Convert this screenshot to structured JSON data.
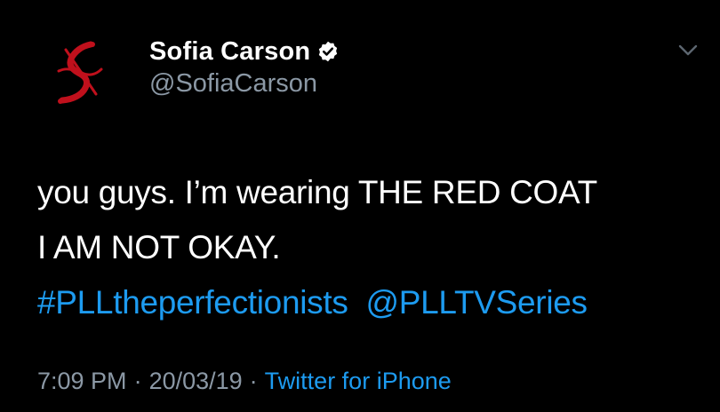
{
  "tweet": {
    "author": {
      "display_name": "Sofia Carson",
      "handle": "@SofiaCarson",
      "verified": true,
      "avatar_icon": "red-s-monogram-icon"
    },
    "body": {
      "line1": "you guys. I’m wearing THE RED COAT",
      "line2": "I AM NOT OKAY.",
      "hashtag": "#PLLtheperfectionists",
      "mention": "@PLLTVSeries"
    },
    "meta": {
      "time": "7:09 PM",
      "separator": "·",
      "date": "20/03/19",
      "source": "Twitter for iPhone"
    }
  },
  "colors": {
    "background": "#000000",
    "text": "#ffffff",
    "secondary": "#8b98a5",
    "link": "#1d9bf0",
    "avatar_accent": "#c0101c"
  }
}
